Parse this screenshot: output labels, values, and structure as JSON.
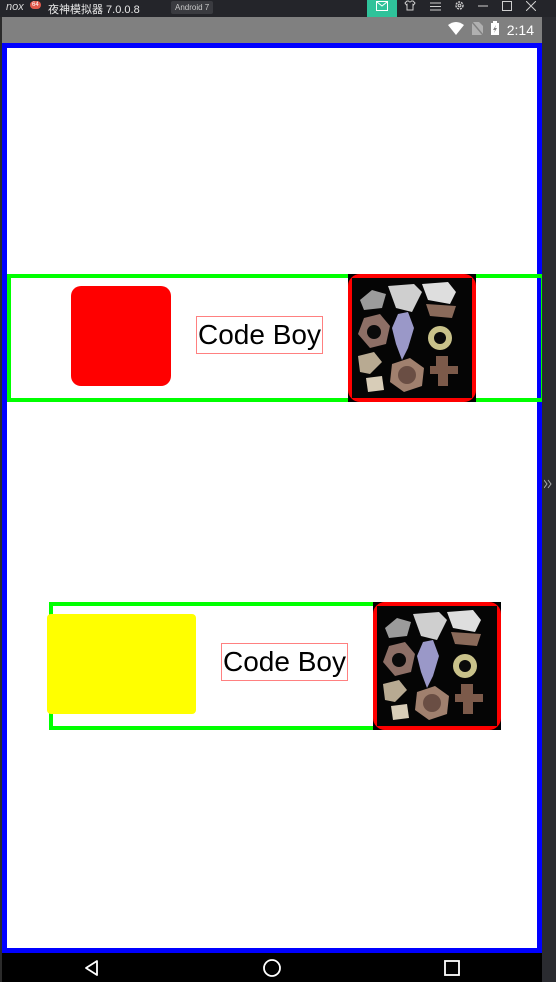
{
  "emulator": {
    "logo": "nox",
    "badge": "64",
    "title": "夜神模拟器 7.0.0.8",
    "android_tag": "Android 7",
    "buttons": [
      "message-icon",
      "shirt-icon",
      "menu-icon",
      "settings-icon",
      "minimize-icon",
      "maximize-icon",
      "close-icon"
    ]
  },
  "status_bar": {
    "time": "2:14",
    "icons": [
      "wifi-icon",
      "no-sim-icon",
      "battery-icon"
    ]
  },
  "rows": [
    {
      "label": "Code Boy",
      "swatch_color": "#ff0000",
      "swatch_shape": "rounded-square"
    },
    {
      "label": "Code Boy",
      "swatch_color": "#ffff00",
      "swatch_shape": "rectangle"
    }
  ],
  "colors": {
    "outer_border": "#0000ff",
    "row_border": "#00ff00",
    "tile_border": "#ff0000",
    "label_border": "#ff8080"
  },
  "navbar": {
    "buttons": [
      "back-icon",
      "home-icon",
      "recent-apps-icon"
    ]
  }
}
